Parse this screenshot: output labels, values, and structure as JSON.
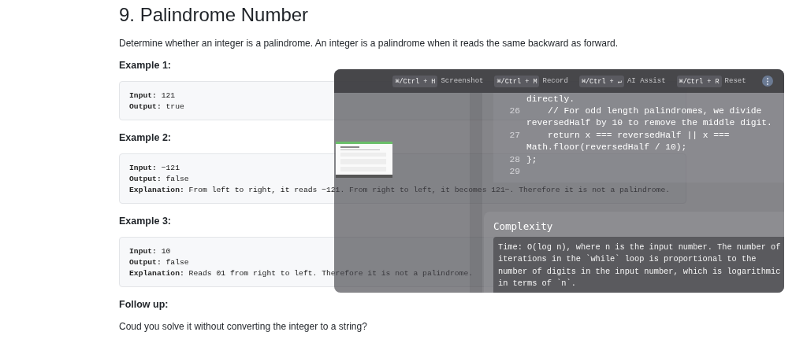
{
  "page": {
    "title": "9. Palindrome Number",
    "description": "Determine whether an integer is a palindrome. An integer is a palindrome when it reads the same backward as forward.",
    "examples": [
      {
        "heading": "Example 1:",
        "lines": [
          {
            "label": "Input:",
            "value": "121"
          },
          {
            "label": "Output:",
            "value": "true"
          }
        ]
      },
      {
        "heading": "Example 2:",
        "lines": [
          {
            "label": "Input:",
            "value": "−121"
          },
          {
            "label": "Output:",
            "value": "false"
          },
          {
            "label": "Explanation:",
            "value": "From left to right, it reads −121. From right to left, it becomes 121−. Therefore it is not a palindrome."
          }
        ]
      },
      {
        "heading": "Example 3:",
        "lines": [
          {
            "label": "Input:",
            "value": "10"
          },
          {
            "label": "Output:",
            "value": "false"
          },
          {
            "label": "Explanation:",
            "value": "Reads 01 from right to left. Therefore it is not a palindrome."
          }
        ]
      }
    ],
    "follow_up": {
      "heading": "Follow up:",
      "text": "Coud you solve it without converting the integer to a string?"
    }
  },
  "overlay": {
    "shortcuts": [
      {
        "keys": "⌘/Ctrl + H",
        "label": "Screenshot"
      },
      {
        "keys": "⌘/Ctrl + M",
        "label": "Record"
      },
      {
        "keys": "⌘/Ctrl + ↵",
        "label": "AI Assist"
      },
      {
        "keys": "⌘/Ctrl + R",
        "label": "Reset"
      }
    ],
    "code": {
      "lines": [
        {
          "text": "directly."
        },
        {
          "number": "26",
          "text": "    // For odd length palindromes, we divide"
        },
        {
          "text": "reversedHalf by 10 to remove the middle digit."
        },
        {
          "number": "27",
          "text": "    return x === reversedHalf || x ==="
        },
        {
          "text": "Math.floor(reversedHalf / 10);"
        },
        {
          "number": "28",
          "text": "};"
        },
        {
          "number": "29"
        }
      ]
    },
    "complexity": {
      "title": "Complexity",
      "text": "Time: O(log n), where n is the input number. The number of iterations in the `while` loop is proportional to the number of digits in the input number, which is logarithmic in terms of `n`."
    }
  }
}
